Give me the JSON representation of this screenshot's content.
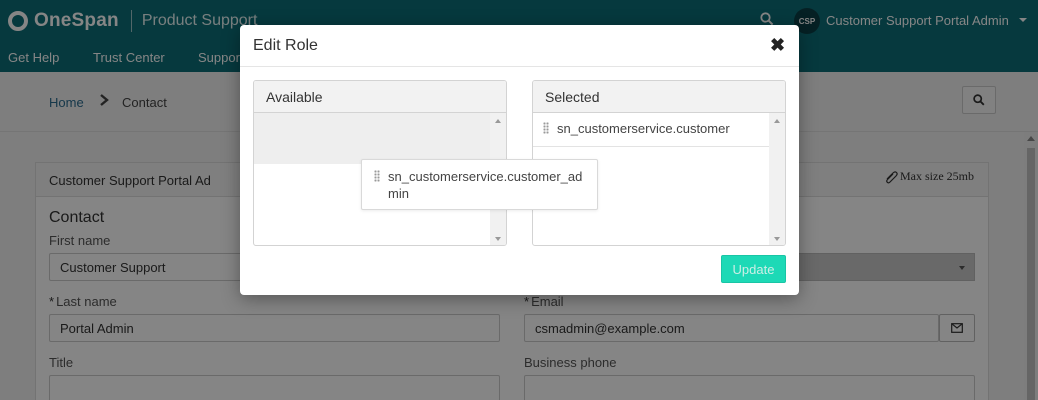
{
  "header": {
    "brand": "OneSpan",
    "product": "Product Support",
    "user_initials": "CSP",
    "user_name": "Customer Support Portal Admin"
  },
  "nav": {
    "items": [
      "Get Help",
      "Trust Center",
      "Support"
    ]
  },
  "breadcrumb": {
    "home": "Home",
    "current": "Contact"
  },
  "form": {
    "card_title": "Customer Support Portal Ad",
    "max_size": "Max size 25mb",
    "section_title": "Contact",
    "first_name_label": "First name",
    "first_name_value": "Customer Support",
    "last_name_label": "Last name",
    "last_name_value": "Portal Admin",
    "email_label": "Email",
    "email_value": "csmadmin@example.com",
    "title_label": "Title",
    "business_phone_label": "Business phone",
    "required_mark": "*"
  },
  "modal": {
    "title": "Edit Role",
    "close_symbol": "✖",
    "available_header": "Available",
    "selected_header": "Selected",
    "selected_items": [
      "sn_customerservice.customer"
    ],
    "dragging_item": "sn_customerservice.customer_admin",
    "update_label": "Update"
  },
  "colors": {
    "header_bg": "#0d6e78",
    "update_button": "#1dd9b6",
    "overlay": "rgba(0,0,0,0.48)"
  },
  "icons": {
    "search": "search-icon",
    "close": "close-icon",
    "paperclip": "paperclip-icon",
    "mail": "envelope-icon",
    "drag": "drag-handle-icon"
  }
}
